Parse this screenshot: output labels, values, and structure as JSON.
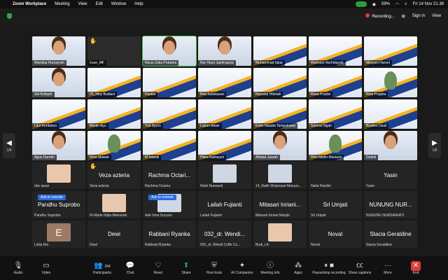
{
  "menubar": {
    "app": "Zoom Workplace",
    "items": [
      "Meeting",
      "View",
      "Edit",
      "Window",
      "Help"
    ],
    "battery": "59%",
    "datetime": "Fri 14 Nov 21.38"
  },
  "topbar": {
    "recording": "Recording...",
    "sign_in": "Sign in",
    "view": "View"
  },
  "paging": {
    "left": "1/8",
    "right": "1/8"
  },
  "video_tiles": [
    "Wardina Humayrah",
    "Irsan_MF",
    "Nicus Zaka Pratama",
    "Nur Hasri Jaelmaju/ai",
    "Muhammad Iqbal",
    "Wahidun Nurhidayah",
    "Meryani Haruni",
    "Siti Rofiqoh",
    "23_Nisy Budiani",
    "Dastini",
    "Reti Sulistiasari",
    "Nurzulul Hilmiah",
    "Rosa Pradivi",
    "Reni Puspita",
    "Lilur Kordiatun",
    "Martin Ayu",
    "Yuli Sya'in",
    "Lupan Aikan",
    "Ester Natalia Tampubolon",
    "Samsul Ngah",
    "Bustien Dauli",
    "Agus Durmin",
    "Vera Slawati",
    "M Irawati",
    "Haka Rahayuni",
    "Ahlatul Jaarah",
    "Wini Ikkdin Maviarin",
    "Dodoli"
  ],
  "name_tiles": [
    {
      "big": "",
      "label": "riko awan"
    },
    {
      "big": "Veza azteria",
      "label": "Veza azteria"
    },
    {
      "big": "Rachma Octari...",
      "label": "Rachma Octaria"
    },
    {
      "big": "",
      "label": "Ninik Nurwanti"
    },
    {
      "big": "",
      "label": "14_Ratih Wulansari Marsus..."
    },
    {
      "big": "",
      "label": "Naila Hardini"
    },
    {
      "big": "Yasin",
      "label": "Yasin"
    },
    {
      "big": "Pandhu Suprobo",
      "label": "Pandhu Suprobo"
    },
    {
      "big": "",
      "label": "Ni Made Nijita Maharlati"
    },
    {
      "big": "",
      "label": "Ade Irma Suryani"
    },
    {
      "big": "Lailah Fujianti",
      "label": "Lailah Fujianti"
    },
    {
      "big": "Mitasari Inriani...",
      "label": "Mitasari Inriani Manjiri"
    },
    {
      "big": "Sri Umjati",
      "label": "Sri Umjati"
    },
    {
      "big": "NUNUNG NUR...",
      "label": "NUNUNG NURSAWIATI"
    },
    {
      "big": "E",
      "label": "Lislia Ela"
    },
    {
      "big": "Dewi",
      "label": "Dewi"
    },
    {
      "big": "Rabbani Ryanka",
      "label": "Rabbani Ryanka"
    },
    {
      "big": "032_dr. Wendi...",
      "label": "032_dr. Wendi Coffe Co..."
    },
    {
      "big": "",
      "label": "Budi_LA"
    },
    {
      "big": "Noval",
      "label": "Noval"
    },
    {
      "big": "Stacia Geraldine",
      "label": "Stacia Geraldine"
    }
  ],
  "unmute_label": "Ask to unmute",
  "toolbar": {
    "audio": "Audio",
    "video": "Video",
    "participants": "Participants",
    "participants_count": "284",
    "chat": "Chat",
    "react": "React",
    "share": "Share",
    "host_tools": "Host tools",
    "ai_companion": "AI Companion",
    "meeting_info": "Meeting info",
    "apps": "Apps",
    "pause_recording": "Pause/stop recording",
    "captions": "Show captions",
    "more": "More",
    "end": "End"
  }
}
